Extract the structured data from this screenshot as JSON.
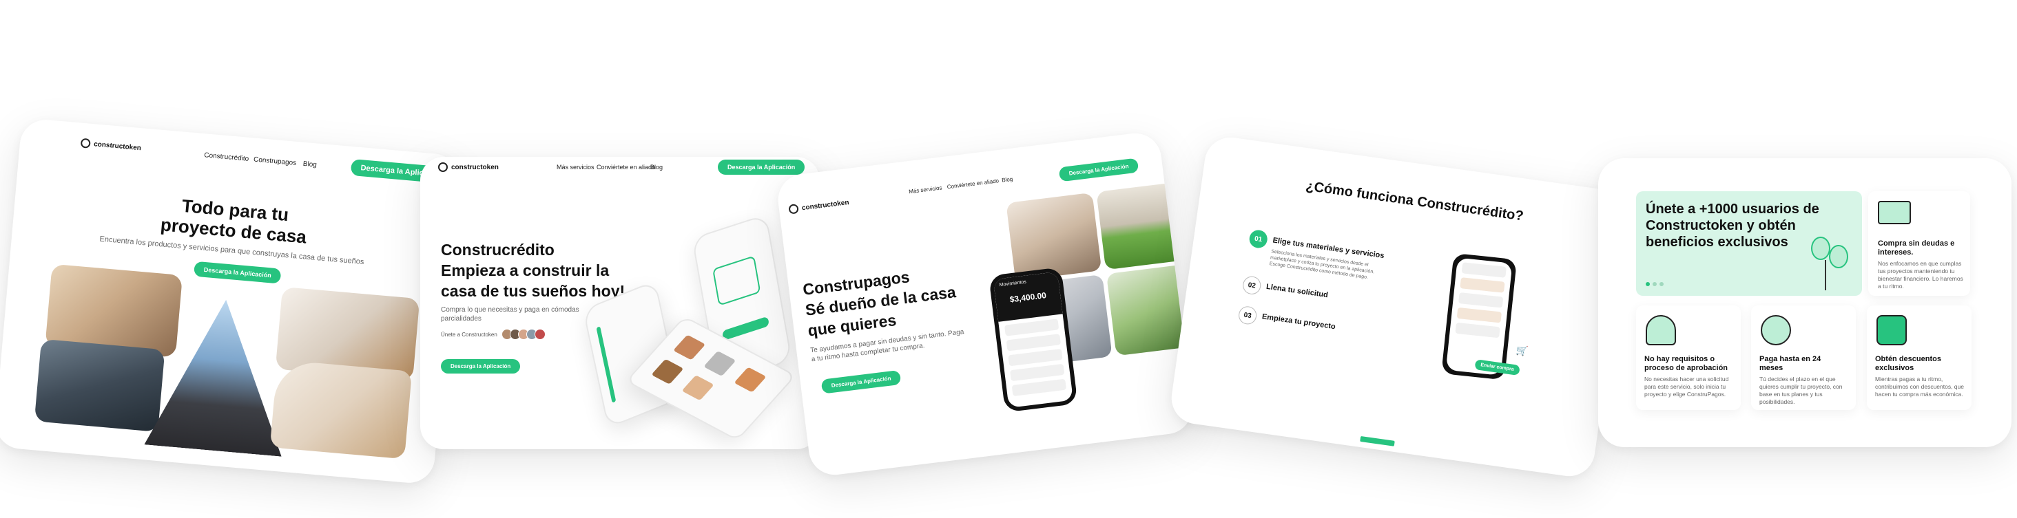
{
  "card1": {
    "logo": "constructoken",
    "nav": [
      "Construcrédito",
      "Construpagos",
      "Blog"
    ],
    "cta": "Descarga la Aplicación",
    "title_line1": "Todo para tu",
    "title_line2": "proyecto de casa",
    "subtitle": "Encuentra los productos y servicios para que construyas la casa de tus sueños",
    "hero_cta": "Descarga la Aplicación"
  },
  "card2": {
    "logo": "constructoken",
    "nav": [
      "Más servicios",
      "Conviértete en aliado",
      "Blog"
    ],
    "cta": "Descarga la Aplicación",
    "title_line1": "Construcrédito",
    "title_line2": "Empieza a construir la",
    "title_line3": "casa de tus sueños hoy!",
    "subtitle_line1": "Compra lo que necesitas y paga en cómodas",
    "subtitle_line2": "parcialidades",
    "users_label": "Únete a Constructoken",
    "hero_cta": "Descarga la Aplicación"
  },
  "card3": {
    "logo": "constructoken",
    "nav": [
      "Más servicios",
      "Conviértete en aliado",
      "Blog"
    ],
    "cta": "Descarga la Aplicación",
    "title_line1": "Construpagos",
    "title_line2": "Sé dueño de la casa",
    "title_line3": "que quieres",
    "subtitle_line1": "Te ayudamos a pagar sin deudas y sin tanto. Paga",
    "subtitle_line2": "a tu ritmo hasta completar tu compra.",
    "hero_cta": "Descarga la Aplicación",
    "phone_header": "Movimientos",
    "phone_balance": "$3,400.00"
  },
  "card4": {
    "title": "¿Cómo funciona Construcrédito?",
    "steps": [
      {
        "num": "01",
        "label": "Elige tus materiales y servicios",
        "desc": "Selecciona los materiales y servicios desde el marketplace y cotiza tu proyecto en la aplicación. Escoge Construcrédito como método de pago."
      },
      {
        "num": "02",
        "label": "Llena tu solicitud"
      },
      {
        "num": "03",
        "label": "Empieza tu proyecto"
      }
    ],
    "phone_button": "Enviar compra"
  },
  "card5": {
    "hero_title_line1": "Únete a +1000 usuarios de",
    "hero_title_line2": "Constructoken y obtén",
    "hero_title_line3": "beneficios exclusivos",
    "benefits": [
      {
        "title_line1": "Compra sin deudas e",
        "title_line2": "intereses.",
        "text": "Nos enfocamos en que cumplas tus proyectos manteniendo tu bienestar financiero. Lo haremos a tu ritmo."
      },
      {
        "title_line1": "No hay requisitos o",
        "title_line2": "proceso de aprobación",
        "text": "No necesitas hacer una solicitud para este servicio, solo inicia tu proyecto y elige ConstruPagos."
      },
      {
        "title_line1": "Paga hasta en 24",
        "title_line2": "meses",
        "text": "Tú decides el plazo en el que quieres cumplir tu proyecto, con base en tus planes y tus posibilidades."
      },
      {
        "title_line1": "Obtén descuentos",
        "title_line2": "exclusivos",
        "text": "Mientras pagas a tu ritmo, contribuimos con descuentos, que hacen tu compra más económica."
      }
    ]
  },
  "colors": {
    "accent": "#27c37f",
    "mint": "#d7f5e7"
  }
}
